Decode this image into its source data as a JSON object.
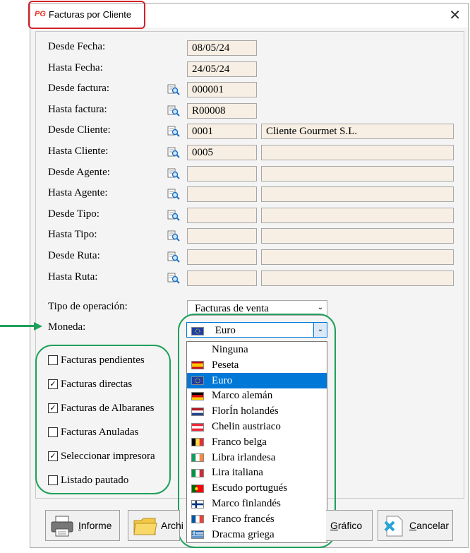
{
  "window": {
    "title": "Facturas por Cliente",
    "app_icon": "PG",
    "close_label": "✕"
  },
  "fields": [
    {
      "label": "Desde Fecha:",
      "value": "08/05/24"
    },
    {
      "label": "Hasta Fecha:",
      "value": "24/05/24"
    },
    {
      "label": "Desde factura:",
      "value": "000001"
    },
    {
      "label": "Hasta factura:",
      "value": "R00008"
    },
    {
      "label": "Desde Cliente:",
      "value": "0001",
      "desc": "Cliente Gourmet S.L."
    },
    {
      "label": "Hasta Cliente:",
      "value": "0005",
      "desc": ""
    },
    {
      "label": "Desde Agente:",
      "value": "",
      "desc": ""
    },
    {
      "label": "Hasta Agente:",
      "value": "",
      "desc": ""
    },
    {
      "label": "Desde Tipo:",
      "value": "",
      "desc": ""
    },
    {
      "label": "Hasta Tipo:",
      "value": "",
      "desc": ""
    },
    {
      "label": "Desde Ruta:",
      "value": "",
      "desc": ""
    },
    {
      "label": "Hasta Ruta:",
      "value": "",
      "desc": ""
    }
  ],
  "tipo_operacion": {
    "label": "Tipo de operación:",
    "value": "Facturas de venta"
  },
  "moneda": {
    "label": "Moneda:",
    "value": "Euro",
    "options": [
      {
        "label": "Ninguna",
        "flag": "none"
      },
      {
        "label": "Peseta",
        "flag": "spain-flag"
      },
      {
        "label": "Euro",
        "flag": "eu-flag",
        "selected": true
      },
      {
        "label": "Marco alemán",
        "flag": "germany-flag"
      },
      {
        "label": "FlorÍn holandés",
        "flag": "netherlands-flag"
      },
      {
        "label": "Chelin austriaco",
        "flag": "austria-flag"
      },
      {
        "label": "Franco belga",
        "flag": "belgium-flag"
      },
      {
        "label": "Libra irlandesa",
        "flag": "ireland-flag"
      },
      {
        "label": "Lira italiana",
        "flag": "italy-flag"
      },
      {
        "label": "Escudo portugués",
        "flag": "portugal-flag"
      },
      {
        "label": "Marco finlandés",
        "flag": "finland-flag"
      },
      {
        "label": "Franco francés",
        "flag": "france-flag"
      },
      {
        "label": "Dracma griega",
        "flag": "greece-flag"
      }
    ]
  },
  "checkboxes": [
    {
      "label": "Facturas pendientes",
      "checked": false
    },
    {
      "label": "Facturas directas",
      "checked": true
    },
    {
      "label": "Facturas de Albaranes",
      "checked": true
    },
    {
      "label": "Facturas Anuladas",
      "checked": false
    },
    {
      "label": "Seleccionar impresora",
      "checked": true
    },
    {
      "label": "Listado pautado",
      "checked": false
    }
  ],
  "buttons": {
    "informe_first": "I",
    "informe_rest": "nforme",
    "archivo": "Archi",
    "grafico_first": "G",
    "grafico_rest": "ráfico",
    "cancelar_first": "C",
    "cancelar_rest": "ancelar"
  },
  "colors": {
    "highlight_red": "#d2232a",
    "highlight_green": "#1fa05a",
    "field_bg": "#f7efe4",
    "selected": "#0078d7"
  }
}
